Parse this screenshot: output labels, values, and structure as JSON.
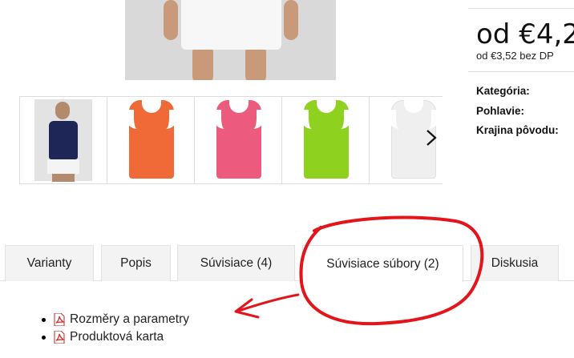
{
  "price": {
    "main": "od €4,2",
    "without_vat": "od €3,52 bez DP"
  },
  "attributes": [
    {
      "label": "Kategória:"
    },
    {
      "label": "Pohlavie:"
    },
    {
      "label": "Krajina pôvodu:"
    }
  ],
  "thumbnails": [
    {
      "name": "model",
      "color": "#1d2656"
    },
    {
      "name": "orange",
      "color": "#ef6a36"
    },
    {
      "name": "pink",
      "color": "#ec5a7d"
    },
    {
      "name": "lime",
      "color": "#8fd11f"
    },
    {
      "name": "white",
      "color": "#f1f1f1"
    }
  ],
  "tabs": [
    {
      "label": "Varianty"
    },
    {
      "label": "Popis"
    },
    {
      "label": "Súvisiace (4)"
    },
    {
      "label": "Súvisiace súbory (2)",
      "active": true
    },
    {
      "label": "Diskusia"
    }
  ],
  "files": [
    {
      "label": "Rozměry a parametry"
    },
    {
      "label": "Produktová karta"
    }
  ],
  "annotation_color": "#e3151a",
  "icons": {
    "next": "chevron-right-icon",
    "pdf": "pdf-icon"
  }
}
